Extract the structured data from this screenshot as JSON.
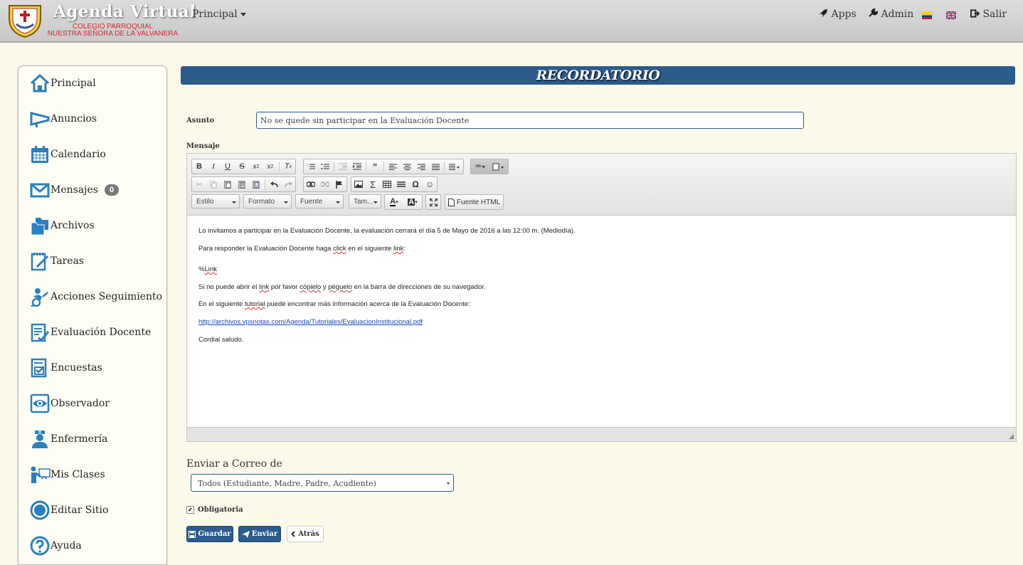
{
  "navbar": {
    "brand_title": "Agenda Virtual",
    "brand_sub_line1": "COLEGIO PARROQUIAL",
    "brand_sub_line2": "NUESTRA SEÑORA DE LA VALVANERA",
    "principal": "Principal",
    "apps": "Apps",
    "admin": "Admin",
    "salir": "Salir"
  },
  "sidebar": {
    "items": [
      {
        "label": "Principal",
        "icon": "home-icon"
      },
      {
        "label": "Anuncios",
        "icon": "megaphone-icon"
      },
      {
        "label": "Calendario",
        "icon": "calendar-icon"
      },
      {
        "label": "Mensajes",
        "icon": "envelope-icon",
        "badge": "0"
      },
      {
        "label": "Archivos",
        "icon": "folders-icon"
      },
      {
        "label": "Tareas",
        "icon": "tasks-icon"
      },
      {
        "label": "Acciones Seguimiento",
        "icon": "followup-icon"
      },
      {
        "label": "Evaluación Docente",
        "icon": "evaluation-icon"
      },
      {
        "label": "Encuestas",
        "icon": "survey-icon"
      },
      {
        "label": "Observador",
        "icon": "eye-icon"
      },
      {
        "label": "Enfermería",
        "icon": "nurse-icon"
      },
      {
        "label": "Mis Clases",
        "icon": "teacher-icon"
      },
      {
        "label": "Editar Sitio",
        "icon": "edit-site-icon"
      },
      {
        "label": "Ayuda",
        "icon": "help-icon"
      }
    ]
  },
  "page": {
    "title": "RECORDATORIO",
    "asunto_label": "Asunto",
    "asunto_value": "No se quede sin participar en la Evaluación Docente",
    "mensaje_label": "Mensaje"
  },
  "editor": {
    "combos": {
      "estilo": "Estilo",
      "formato": "Formato",
      "fuente": "Fuente",
      "tamano": "Tam..."
    },
    "source_button": "Fuente HTML",
    "lines": {
      "l1": "Lo invitamos a participar en la Evaluación Docente, la evaluación cerrará el día 5 de Mayo de 2016 a las 12:00 m. (Mediodía).",
      "l2a": "Para responder la Evaluación Docente haga ",
      "l2b": "click",
      "l2c": " en el siguiente ",
      "l2d": "link",
      "l2e": ":",
      "l3a": "%",
      "l3b": "Link",
      "l4a": "Si no puede abrir el ",
      "l4b": "link",
      "l4c": " por favor ",
      "l4d": "cópielo",
      "l4e": " y ",
      "l4f": "péguelo",
      "l4g": " en la barra de direcciones de su navegador.",
      "l5a": "En el siguiente ",
      "l5b": "tutorial",
      "l5c": " puede encontrar más información acerca de la Evaluación Docente:",
      "l6": "http://archivos.vpsnotas.com/Agenda/Tutoriales/EvaluacionInstitucional.pdf",
      "l7": "Cordial saludo."
    }
  },
  "send": {
    "label": "Enviar a Correo de",
    "selected": "Todos (Estudiante, Madre, Padre, Acudiente)",
    "obligatoria": "Obligatoria"
  },
  "buttons": {
    "guardar": "Guardar",
    "enviar": "Enviar",
    "atras": "Atrás"
  },
  "colors": {
    "primary": "#2c5b8c",
    "background": "#fbf9ea",
    "icon_blue": "#2a7fc1"
  }
}
